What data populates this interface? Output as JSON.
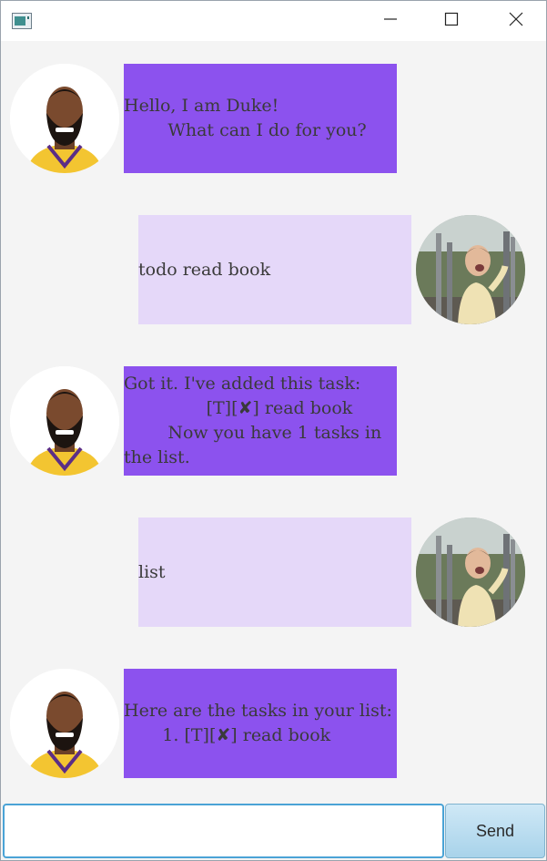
{
  "window": {
    "icon": "app-icon",
    "controls": [
      "minimize-icon",
      "maximize-icon",
      "close-icon"
    ]
  },
  "messages": [
    {
      "sender": "duke",
      "avatar": "duke-avatar",
      "text": "Hello, I am Duke!\n        What can I do for you?"
    },
    {
      "sender": "user",
      "avatar": "user-avatar",
      "text": "todo read book"
    },
    {
      "sender": "duke",
      "avatar": "duke-avatar",
      "text": "Got it. I've added this task:\n               [T][✘] read book\n        Now you have 1 tasks in the list."
    },
    {
      "sender": "user",
      "avatar": "user-avatar",
      "text": "list"
    },
    {
      "sender": "duke",
      "avatar": "duke-avatar",
      "text": "Here are the tasks in your list:\n       1. [T][✘] read book"
    }
  ],
  "input": {
    "value": "",
    "placeholder": ""
  },
  "send_button": {
    "label": "Send"
  },
  "colors": {
    "duke_bubble": "#8c52ee",
    "user_bubble": "#e5d8f9",
    "background": "#f4f4f4",
    "input_focus": "#4aa3d6"
  }
}
